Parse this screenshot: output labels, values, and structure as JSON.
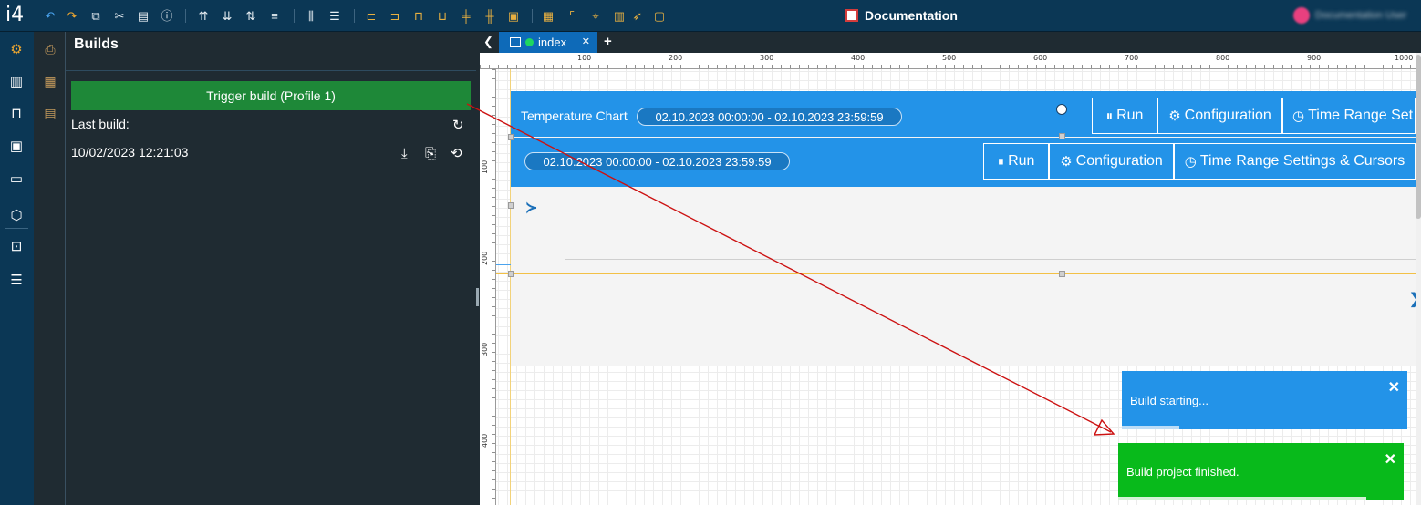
{
  "app": {
    "logo": "i4",
    "title": "Documentation",
    "user_name": "Documentation User"
  },
  "toolbar": {
    "icons": [
      "undo-icon",
      "redo-icon",
      "copy-icon",
      "cut-icon",
      "paste-icon",
      "info-icon",
      "align-top-icon",
      "align-bottom-icon",
      "align-middle-icon",
      "distribute-icon",
      "distribute-h-icon",
      "distribute-v-icon",
      "align-left-icon",
      "align-right-icon",
      "align-top-edge-icon",
      "align-bottom-edge-icon",
      "center-h-icon",
      "center-v-icon",
      "fit-icon",
      "grid-icon",
      "border-icon",
      "anchor-icon",
      "table-icon",
      "pointer-icon",
      "frame-icon"
    ]
  },
  "rail": {
    "icons": [
      "gear-icon",
      "chart-icon",
      "tools-icon",
      "monitor-icon",
      "laptop-icon",
      "cube-icon",
      "analytics-icon",
      "list-icon"
    ],
    "secondary_icons": [
      "printer-icon",
      "chip-icon",
      "document-icon"
    ]
  },
  "builds": {
    "title": "Builds",
    "trigger_label": "Trigger build (Profile 1)",
    "last_build_label": "Last build:",
    "last_build_date": "10/02/2023 12:21:03"
  },
  "tabs": [
    {
      "label": "index",
      "status": "active"
    }
  ],
  "rulers": {
    "top": [
      "100",
      "200",
      "300",
      "400",
      "500",
      "600",
      "700",
      "800",
      "900",
      "1000"
    ],
    "left": [
      "100",
      "200",
      "300",
      "400"
    ]
  },
  "widget": {
    "title": "Temperature Chart",
    "range_1": "02.10.2023 00:00:00 - 02.10.2023 23:59:59",
    "range_2": "02.10.2023 00:00:00 - 02.10.2023 23:59:59",
    "run_label": "Run",
    "config_label": "Configuration",
    "time_range_label_1": "Time Range Set",
    "time_range_label_2": "Time Range Settings & Cursors"
  },
  "notifications": [
    {
      "text": "Build starting...",
      "color": "#2393e8",
      "progress": 0.2
    },
    {
      "text": "Build project finished.",
      "color": "#08ba1b",
      "progress": 0.87
    }
  ],
  "colors": {
    "topbar": "#0b3755",
    "panel": "#1f2b32",
    "trigger": "#1e8838",
    "accent": "#2393e8",
    "arrow": "#cc1111"
  }
}
